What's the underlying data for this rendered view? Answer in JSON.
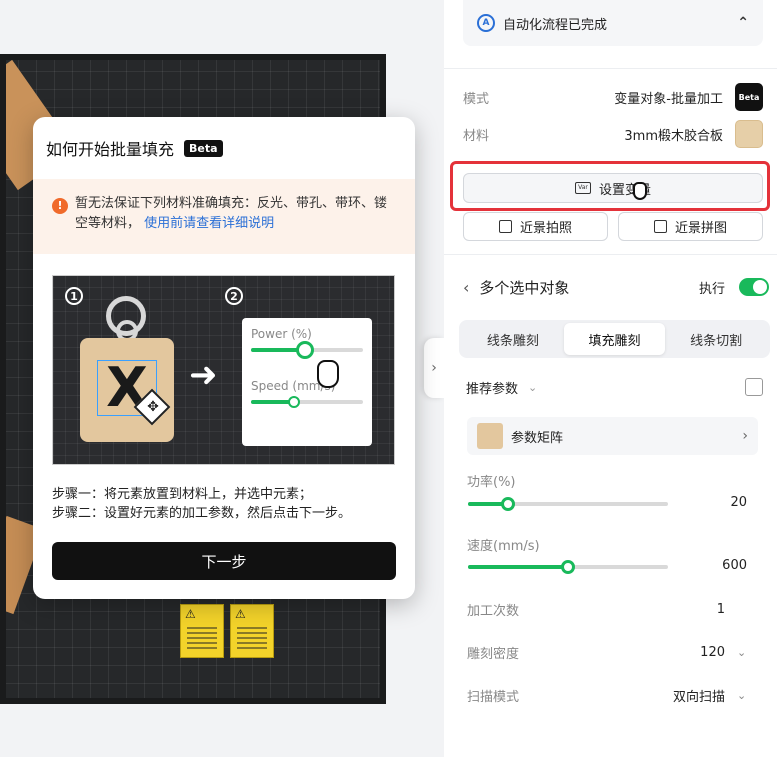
{
  "popup": {
    "title": "如何开始批量填充",
    "beta": "Beta",
    "warning_text": "暂无法保证下列材料准确填充：反光、带孔、带环、镂空等材料，",
    "warning_link": "使用前请查看详细说明",
    "illustration": {
      "step1": "1",
      "step2": "2",
      "power_label": "Power (%)",
      "power_value_pct": 0.48,
      "speed_label": "Speed (mm/s)",
      "speed_value_pct": 0.38
    },
    "step1_text": "步骤一：将元素放置到材料上，并选中元素；",
    "step2_text": "步骤二：设置好元素的加工参数，然后点击下一步。",
    "next_label": "下一步"
  },
  "right_panel": {
    "automation_status": "自动化流程已完成",
    "mode_label": "模式",
    "mode_value": "变量对象-批量加工",
    "mode_badge": "Beta",
    "material_label": "材料",
    "material_value": "3mm椴木胶合板",
    "set_variable_label": "设置变量",
    "closeup_photo_label": "近景拍照",
    "closeup_stitch_label": "近景拼图",
    "selection_title": "多个选中对象",
    "execute_label": "执行",
    "execute_on": true,
    "tabs": [
      "线条雕刻",
      "填充雕刻",
      "线条切割"
    ],
    "active_tab": 1,
    "recommended_label": "推荐参数",
    "param_matrix_label": "参数矩阵",
    "power_label": "功率(%)",
    "power_value": "20",
    "power_fraction": 0.2,
    "speed_label": "速度(mm/s)",
    "speed_value": "600",
    "speed_fraction": 0.5,
    "passes_label": "加工次数",
    "passes_value": "1",
    "density_label": "雕刻密度",
    "density_value": "120",
    "scan_mode_label": "扫描模式",
    "scan_mode_value": "双向扫描"
  },
  "colors": {
    "accent_green": "#19b95b",
    "highlight_red": "#e4323a",
    "link_blue": "#2a6fd6",
    "warning_orange": "#f06a2a"
  },
  "icons": [
    "info-exclamation-icon",
    "automation-icon",
    "chevron-up-icon",
    "var-icon",
    "camera-focus-icon",
    "stitch-icon",
    "chevron-left-icon",
    "chevron-down-icon",
    "save-icon",
    "chevron-right-icon",
    "hand-cursor-icon",
    "move-icon"
  ]
}
